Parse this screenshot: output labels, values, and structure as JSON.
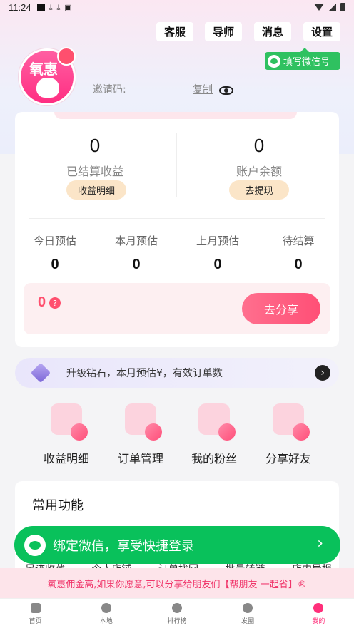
{
  "status_bar": {
    "time": "11:24"
  },
  "header": {
    "buttons": [
      "客服",
      "导师",
      "消息",
      "设置"
    ],
    "wechat_fill_label": "填写微信号",
    "avatar_text": "氧惠",
    "invite_label": "邀请码:",
    "copy_label": "复制"
  },
  "earnings": {
    "settled_value": "0",
    "settled_label": "已结算收益",
    "settled_button": "收益明细",
    "balance_value": "0",
    "balance_label": "账户余额",
    "balance_button": "去提现",
    "estimates": [
      {
        "label": "今日预估",
        "value": "0"
      },
      {
        "label": "本月预估",
        "value": "0"
      },
      {
        "label": "上月预估",
        "value": "0"
      },
      {
        "label": "待结算",
        "value": "0"
      }
    ],
    "share_value": "0",
    "share_button": "去分享"
  },
  "upgrade": {
    "text": "升级钻石，本月预估¥，有效订单数"
  },
  "quick_entries": [
    "收益明细",
    "订单管理",
    "我的粉丝",
    "分享好友"
  ],
  "common": {
    "title": "常用功能",
    "items": [
      "足迹收藏",
      "个人店铺",
      "订单找回",
      "批量转链",
      "店内导报"
    ]
  },
  "bind_wechat": {
    "text": "绑定微信，享受快捷登录"
  },
  "notice": {
    "text": "氧惠佣金高,如果你愿意,可以分享给朋友们【帮朋友 一起省】®"
  },
  "tabbar": {
    "items": [
      "首页",
      "本地",
      "排行榜",
      "发圈",
      "我的"
    ],
    "active": "我的"
  },
  "colors": {
    "accent": "#ff4f6e",
    "wechat_green": "#09c15b",
    "pill_bg": "#fbe5c8"
  }
}
